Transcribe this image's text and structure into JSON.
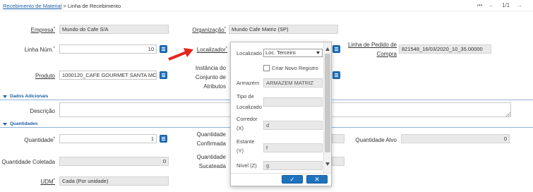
{
  "breadcrumb": {
    "parent": "Recebimento de Material",
    "separator": ">",
    "current": "Linha de Recebimento"
  },
  "pager": {
    "first": "⏮",
    "prev": "←",
    "position": "1/1",
    "next": "→"
  },
  "form": {
    "empresa": {
      "label": "Empresa",
      "value": "Mundo do Cafe S/A"
    },
    "organizacao": {
      "label": "Organização",
      "value": "Mundo Cafe Matriz (SP)"
    },
    "linha_num": {
      "label": "Linha Núm.",
      "value": "10"
    },
    "localizador": {
      "label": "Localizador"
    },
    "linha_pedido": {
      "label_line1": "Linha de Pedido de",
      "label_line2": "Compra",
      "value": "821548_16/03/2020_10_35.00000"
    },
    "produto": {
      "label": "Produto",
      "value": "1000120_CAFE GOURMET SANTA MC"
    },
    "instancia": {
      "line1": "Instância do",
      "line2": "Conjunto de",
      "line3": "Atributos"
    }
  },
  "sections": {
    "dados_adicionais": "Dados Adicionais",
    "quantidades": "Quantidades"
  },
  "descricao": {
    "label": "Descrição",
    "value": ""
  },
  "quantidades": {
    "quantidade": {
      "label": "Quantidade",
      "value": "1"
    },
    "confirmada": {
      "line1": "Quantidade",
      "line2": "Confirmada"
    },
    "alvo": {
      "label": "Quantidade Alvo",
      "value": "0"
    },
    "coletada": {
      "label": "Quantidade Coletada",
      "value": "0"
    },
    "sucateada": {
      "line1": "Quantidade",
      "line2": "Sucateada"
    }
  },
  "udm": {
    "label": "UDM",
    "value": "Cada (Por unidade)"
  },
  "popup": {
    "localizado_label": "Localizado",
    "localizado_value": "Loc. Terceiro",
    "criar_label": "Criar Novo Registro",
    "armazem_label": "Armazém",
    "armazem_value": "ARMAZEM MATRIZ",
    "tipo_line1": "Tipo de",
    "tipo_line2": "Localizado",
    "tipo_value": "",
    "corredor_line1": "Corredor",
    "corredor_line2": "(X)",
    "corredor_value": "d",
    "estante_line1": "Estante",
    "estante_line2": "(Y)",
    "estante_value": "f",
    "nivel_label": "Nível (Z)",
    "nivel_value": "g",
    "ok_glyph": "✓",
    "cancel_glyph": "✕"
  },
  "colors": {
    "accent": "#1e73be",
    "link": "#1f5fa8",
    "arrow": "#e3261b"
  }
}
